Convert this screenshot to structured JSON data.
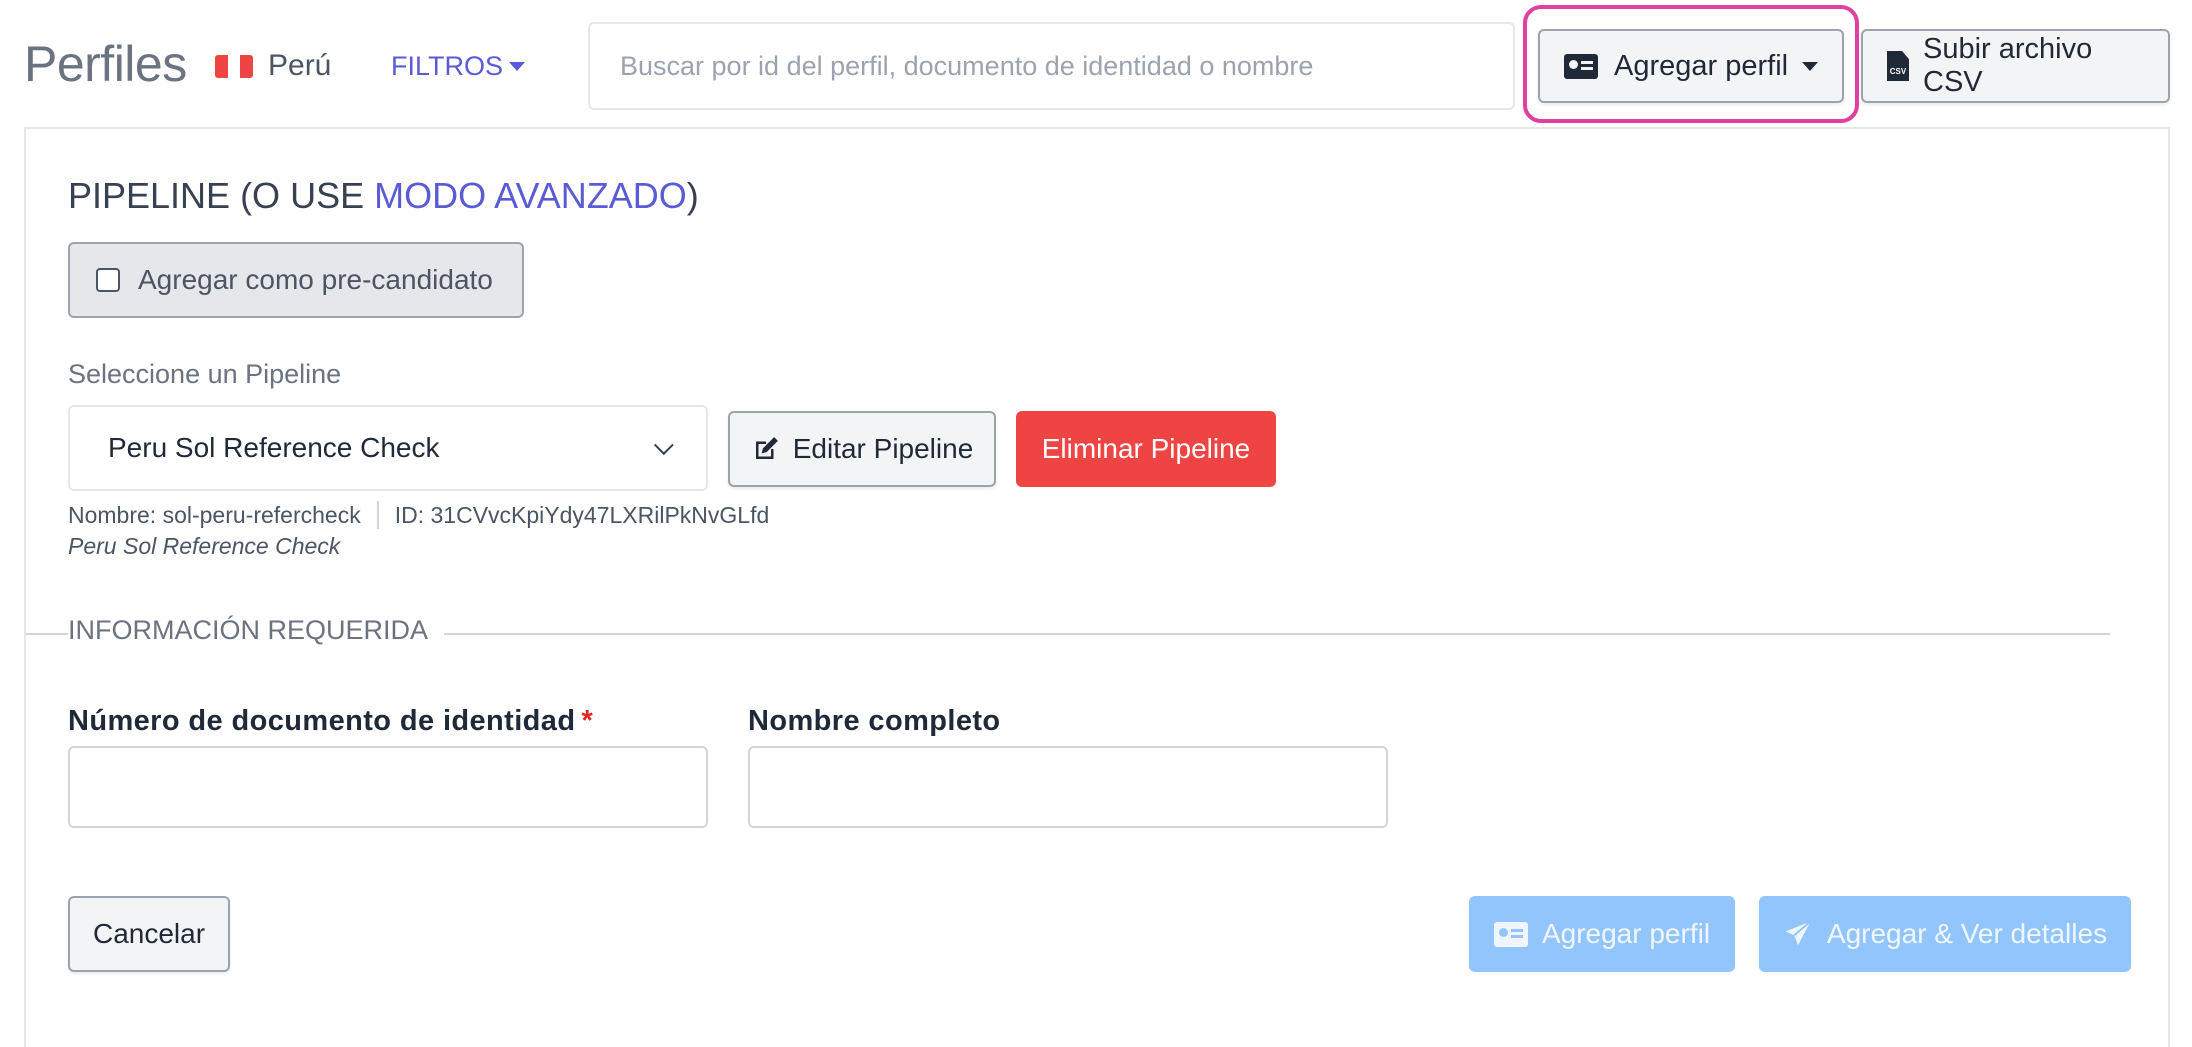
{
  "header": {
    "title": "Perfiles",
    "country": "Perú",
    "filters_label": "FILTROS",
    "search_placeholder": "Buscar por id del perfil, documento de identidad o nombre",
    "add_profile_label": "Agregar perfil",
    "upload_csv_label": "Subir archivo CSV",
    "csv_icon_text": "CSV"
  },
  "pipeline": {
    "heading_prefix": "PIPELINE (O USE ",
    "heading_link": "MODO AVANZADO",
    "heading_suffix": ")",
    "precandidate_label": "Agregar como pre-candidato",
    "select_label": "Seleccione un Pipeline",
    "selected": "Peru Sol Reference Check",
    "edit_label": "Editar Pipeline",
    "delete_label": "Eliminar Pipeline",
    "name_meta": "Nombre: sol-peru-refercheck",
    "id_meta": "ID: 31CVvcKpiYdy47LXRilPkNvGLfd",
    "description": "Peru Sol Reference Check"
  },
  "required_info": {
    "legend": "INFORMACIÓN REQUERIDA",
    "id_document_label": "Número de documento de identidad",
    "required_mark": "*",
    "full_name_label": "Nombre completo"
  },
  "actions": {
    "cancel_label": "Cancelar",
    "add_profile_label": "Agregar perfil",
    "add_and_view_label": "Agregar & Ver detalles"
  },
  "colors": {
    "accent": "#5b5bd6",
    "danger": "#ef4444",
    "highlight": "#e040a0",
    "disabled_primary": "#93c5fd"
  }
}
